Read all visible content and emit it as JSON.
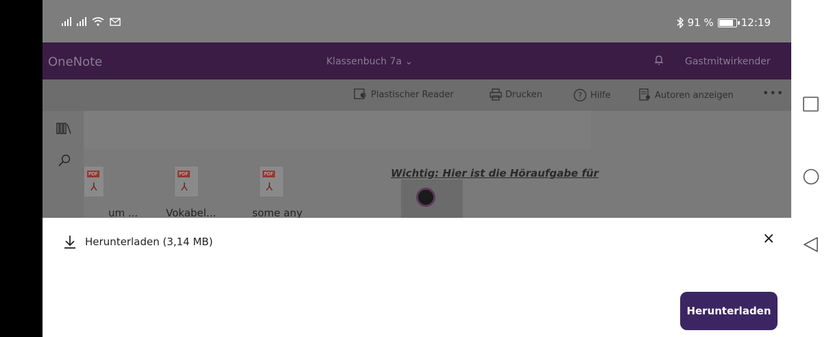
{
  "status_bar": {
    "battery_percent": "91 %",
    "battery_level": 0.91,
    "time": "12:19"
  },
  "app_header": {
    "app_name": "OneNote",
    "notebook_title": "Klassenbuch 7a",
    "notebook_chevron": "⌄",
    "user_label": "Gastmitwirkender"
  },
  "toolbar": {
    "immersive_reader": "Plastischer Reader",
    "print": "Drucken",
    "help": "Hilfe",
    "show_authors": "Autoren anzeigen",
    "more": "•••"
  },
  "page": {
    "attachments": [
      {
        "label": "um ...",
        "tag": "PDF"
      },
      {
        "label": "Vokabel...",
        "tag": "PDF"
      },
      {
        "label": "some any",
        "tag": "PDF"
      }
    ],
    "headline": "Wichtig: Hier ist die Höraufgabe für"
  },
  "download_sheet": {
    "title": "Herunterladen (3,14 MB)",
    "close": "×",
    "button_label": "Herunterladen"
  },
  "colors": {
    "header_purple": "#3b1c45",
    "button_purple": "#3b2663"
  }
}
